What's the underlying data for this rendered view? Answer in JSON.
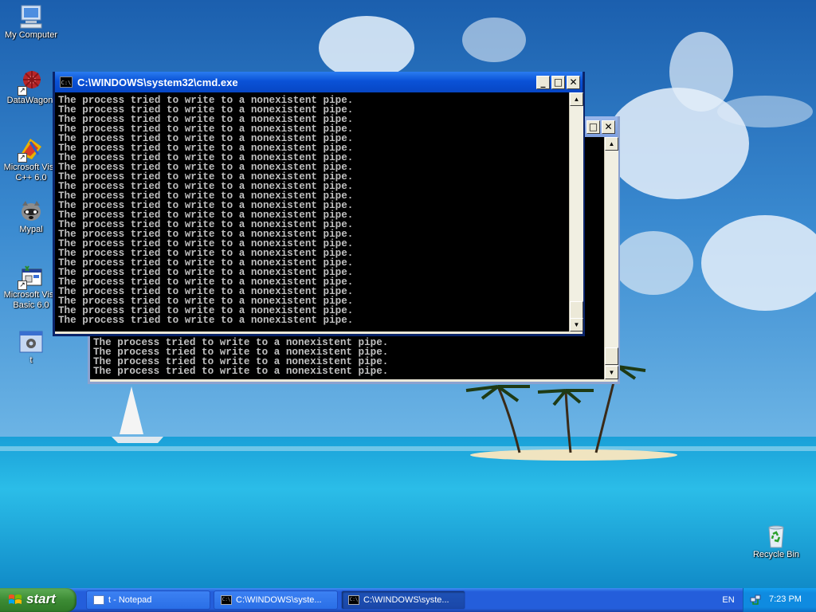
{
  "desktop": {
    "icons": [
      {
        "label": "My Computer"
      },
      {
        "label": "DataWagon."
      },
      {
        "label_line1": "Microsoft Visu",
        "label_line2": "C++ 6.0"
      },
      {
        "label": "Mypal"
      },
      {
        "label_line1": "Microsoft Visu",
        "label_line2": "Basic 6.0"
      },
      {
        "label": "t"
      },
      {
        "label": "Recycle Bin"
      }
    ]
  },
  "windows": {
    "front": {
      "title": "C:\\WINDOWS\\system32\\cmd.exe",
      "icon_text": "C:\\",
      "buttons": {
        "minimize": "_",
        "maximize": "□",
        "close": "✕"
      },
      "lines": [
        "The process tried to write to a nonexistent pipe.",
        "The process tried to write to a nonexistent pipe.",
        "The process tried to write to a nonexistent pipe.",
        "The process tried to write to a nonexistent pipe.",
        "The process tried to write to a nonexistent pipe.",
        "The process tried to write to a nonexistent pipe.",
        "The process tried to write to a nonexistent pipe.",
        "The process tried to write to a nonexistent pipe.",
        "The process tried to write to a nonexistent pipe.",
        "The process tried to write to a nonexistent pipe.",
        "The process tried to write to a nonexistent pipe.",
        "The process tried to write to a nonexistent pipe.",
        "The process tried to write to a nonexistent pipe.",
        "The process tried to write to a nonexistent pipe.",
        "The process tried to write to a nonexistent pipe.",
        "The process tried to write to a nonexistent pipe.",
        "The process tried to write to a nonexistent pipe.",
        "The process tried to write to a nonexistent pipe.",
        "The process tried to write to a nonexistent pipe.",
        "The process tried to write to a nonexistent pipe.",
        "The process tried to write to a nonexistent pipe.",
        "The process tried to write to a nonexistent pipe.",
        "The process tried to write to a nonexistent pipe.",
        "The process tried to write to a nonexistent pipe."
      ]
    },
    "back": {
      "buttons": {
        "maximize": "□",
        "close": "✕"
      },
      "lines": [
        "The process tried to write to a nonexistent pipe.",
        "The process tried to write to a nonexistent pipe.",
        "The process tried to write to a nonexistent pipe.",
        "The process tried to write to a nonexistent pipe."
      ]
    }
  },
  "taskbar": {
    "start_label": "start",
    "items": [
      {
        "label": "t - Notepad",
        "icon": "notepad-icon"
      },
      {
        "label": "C:\\WINDOWS\\syste...",
        "icon": "cmd-icon"
      },
      {
        "label": "C:\\WINDOWS\\syste...",
        "icon": "cmd-icon",
        "active": true
      }
    ],
    "language": "EN",
    "clock": "7:23 PM"
  },
  "colors": {
    "console_bg": "#000000",
    "console_text": "#c0c0c0",
    "titlebar": "#0a52d7",
    "taskbar": "#245edb",
    "start": "#3c8b34"
  }
}
